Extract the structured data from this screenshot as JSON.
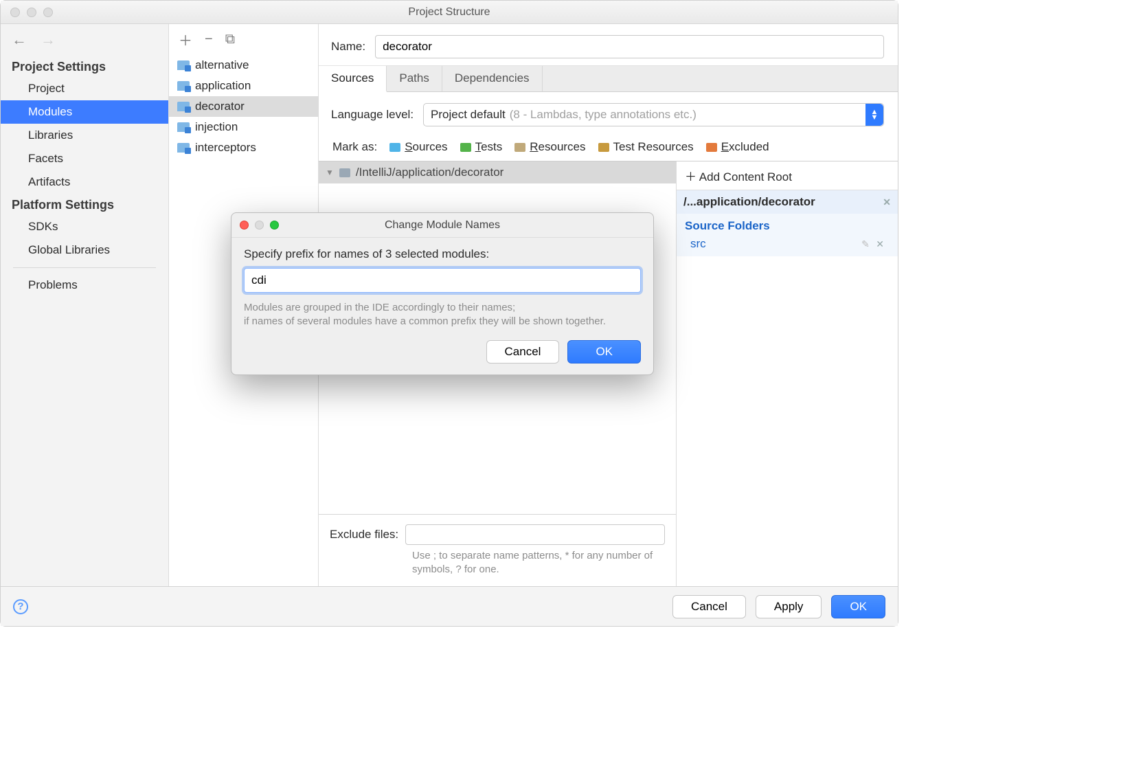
{
  "window": {
    "title": "Project Structure"
  },
  "sidebar": {
    "section1": "Project Settings",
    "items1": [
      "Project",
      "Modules",
      "Libraries",
      "Facets",
      "Artifacts"
    ],
    "selected1": 1,
    "section2": "Platform Settings",
    "items2": [
      "SDKs",
      "Global Libraries"
    ],
    "section3": "Problems"
  },
  "moduleList": {
    "items": [
      "alternative",
      "application",
      "decorator",
      "injection",
      "interceptors"
    ],
    "selected": 2
  },
  "content": {
    "nameLabel": "Name:",
    "nameValue": "decorator",
    "tabs": [
      "Sources",
      "Paths",
      "Dependencies"
    ],
    "activeTab": 0,
    "langLabel": "Language level:",
    "langValue": "Project default",
    "langHint": "(8 - Lambdas, type annotations etc.)",
    "markAsLabel": "Mark as:",
    "markAs": [
      {
        "label": "Sources",
        "color": "#4fb4e8"
      },
      {
        "label": "Tests",
        "color": "#54b34a"
      },
      {
        "label": "Resources",
        "color": "#b39a6a"
      },
      {
        "label": "Test Resources",
        "color": "#c79a3e"
      },
      {
        "label": "Excluded",
        "color": "#e37a3c"
      }
    ],
    "treePath": "/IntelliJ/application/decorator",
    "excludeLabel": "Exclude files:",
    "excludeHint": "Use ; to separate name patterns, * for any number of symbols, ? for one."
  },
  "rightPanel": {
    "addRoot": "Add Content Root",
    "path": "/...application/decorator",
    "sfHeader": "Source Folders",
    "sfItem": "src"
  },
  "footer": {
    "cancel": "Cancel",
    "apply": "Apply",
    "ok": "OK"
  },
  "modal": {
    "title": "Change Module Names",
    "prompt": "Specify prefix for names of 3 selected modules:",
    "value": "cdi",
    "hint": "Modules are grouped in the IDE accordingly to their names;\nif names of several modules have a common prefix they will be shown together.",
    "cancel": "Cancel",
    "ok": "OK"
  }
}
